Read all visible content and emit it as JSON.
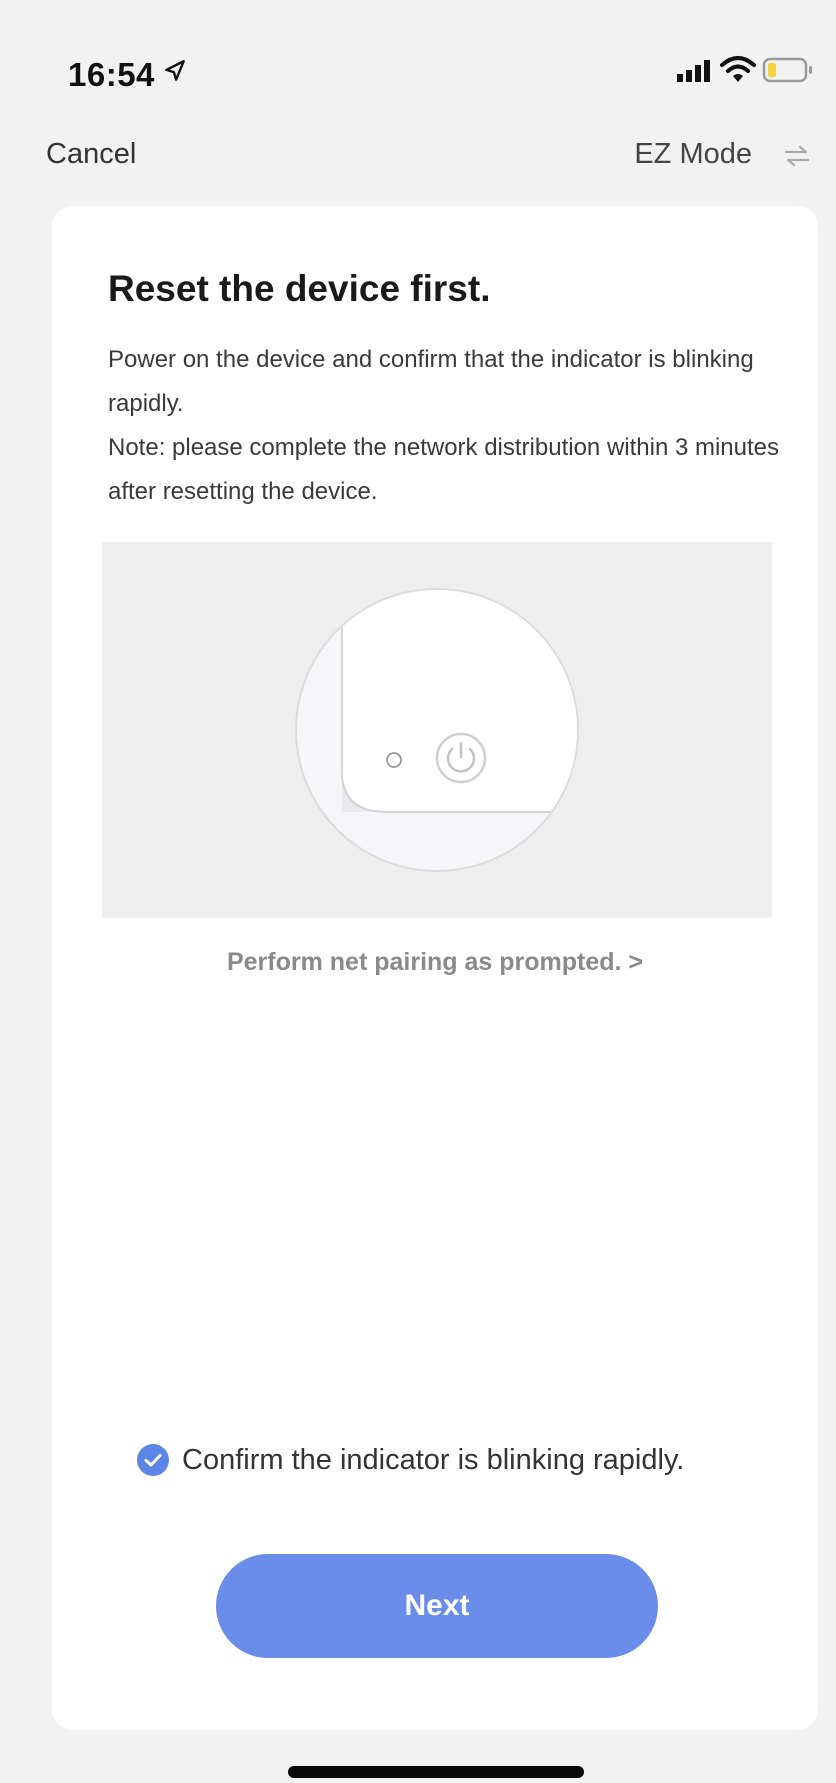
{
  "status_bar": {
    "time": "16:54",
    "icons": [
      "location-arrow-icon",
      "signal-icon",
      "wifi-icon",
      "battery-icon"
    ]
  },
  "nav": {
    "cancel_label": "Cancel",
    "mode_label": "EZ Mode",
    "mode_icon": "swap-arrows-icon"
  },
  "content": {
    "title": "Reset the device first.",
    "description_line1": "Power on the device and confirm that the indicator is blinking rapidly.",
    "description_line2": "Note: please complete the network distribution within 3 minutes after resetting the device.",
    "illustration_icon": "device-power-button-icon",
    "pairing_link": "Perform net pairing as prompted. >",
    "confirm_label": "Confirm the indicator is blinking rapidly.",
    "confirm_checked": true,
    "next_label": "Next"
  },
  "colors": {
    "accent": "#6a8de9",
    "check": "#5b86e5",
    "background": "#f2f2f2",
    "card": "#ffffff"
  }
}
